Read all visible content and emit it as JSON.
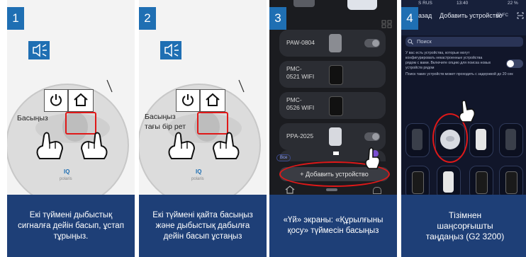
{
  "steps": [
    {
      "number": "1",
      "overlay_label": "Басыңыз",
      "caption": "Екі түймені дыбыстық сигналға дейін басып, ұстап тұрыңыз.",
      "robot_brand": "IQ",
      "robot_model": "polaris"
    },
    {
      "number": "2",
      "overlay_label": "Басыңыз тағы бір рет",
      "caption": "Екі түймені қайта басыңыз және дыбыстық дабылға дейін басып ұстаңыз",
      "robot_brand": "IQ",
      "robot_model": "polaris"
    },
    {
      "number": "3",
      "caption": "«Үй» экраны: «Құрылғыны қосу» түймесін басыңыз"
    },
    {
      "number": "4",
      "caption": "Тізімнен шаңсорғышты таңдаңыз (G2 3200)"
    }
  ],
  "screen3": {
    "devices": [
      "PAW-0804",
      "PMC-0521 WIFI",
      "PMC-0526 WIFI",
      "PPA-2025"
    ],
    "chip_label": "Все",
    "add_button": "+ Добавить устройство"
  },
  "screen4": {
    "status_left": "S RUS",
    "status_time": "13:40",
    "status_right": "22 %",
    "back_label": "азад",
    "title": "Добавить устройство",
    "nfc_label": "NFC",
    "search_placeholder": "Поиск",
    "info_text": "У вас есть устройства, которые могут конфигурировать некастроенные устройства рядом с вами. Включите опцию для поиска новых устройств рядом",
    "delay_text": "Поиск таких устройств может проходить с задержкой до 20 сек"
  },
  "colors": {
    "caption_bg": "#1e3f77",
    "step_badge": "#1f6fb3",
    "highlight": "#e01818"
  },
  "icons": [
    "speaker-icon",
    "power-icon",
    "home-icon",
    "hand-icon",
    "search-icon",
    "nfc-icon",
    "scan-icon"
  ]
}
